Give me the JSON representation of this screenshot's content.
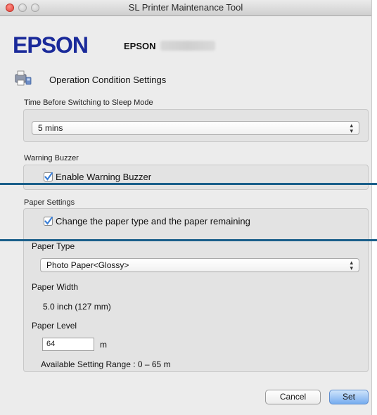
{
  "window": {
    "title": "SL Printer Maintenance Tool"
  },
  "header": {
    "brand": "EPSON",
    "model_prefix": "EPSON"
  },
  "section": {
    "title": "Operation Condition Settings",
    "icon": "printer-settings-icon"
  },
  "sleep": {
    "label": "Time Before Switching to Sleep Mode",
    "value": "5 mins"
  },
  "buzzer": {
    "label": "Warning Buzzer",
    "checkbox_label": "Enable Warning Buzzer",
    "checked": true
  },
  "paper": {
    "label": "Paper Settings",
    "checkbox_label": "Change the paper type and the paper remaining",
    "checked": true,
    "type_label": "Paper Type",
    "type_value": "Photo Paper<Glossy>",
    "width_label": "Paper Width",
    "width_value": "5.0 inch (127 mm)",
    "level_label": "Paper Level",
    "level_value": "64",
    "level_unit": "m",
    "range_text": "Available Setting Range : 0 – 65 m"
  },
  "buttons": {
    "cancel": "Cancel",
    "set": "Set"
  },
  "colors": {
    "brand": "#1a2a9a",
    "callout_line": "#1a5f8a",
    "checkbox": "#3b7fd6"
  }
}
